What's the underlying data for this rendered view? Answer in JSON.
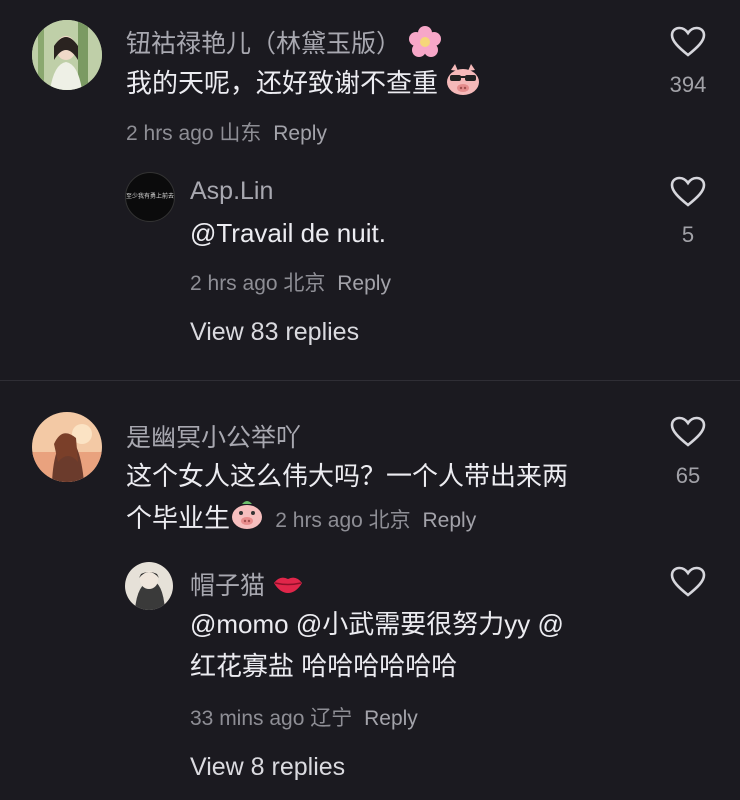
{
  "comments": [
    {
      "username": "钮祜禄艳儿（林黛玉版）",
      "text": "我的天呢，还好致谢不查重",
      "time": "2 hrs ago",
      "location": "山东",
      "reply_label": "Reply",
      "likes": "394",
      "username_emoji": "flower-emoji",
      "text_emoji": "sunglasses-pig-emoji",
      "replies": [
        {
          "username": "Asp.Lin",
          "text": "@Travail de nuit.",
          "time": "2 hrs ago",
          "location": "北京",
          "reply_label": "Reply",
          "likes": "5",
          "avatar_text": "至少我有勇上前去"
        }
      ],
      "view_more": "View 83 replies"
    },
    {
      "username": "是幽冥小公举吖",
      "text_line1": "这个女人这么伟大吗？一个人带出来两",
      "text_line2": "个毕业生",
      "time": "2 hrs ago",
      "location": "北京",
      "reply_label": "Reply",
      "likes": "65",
      "text_emoji": "pig-face-emoji",
      "replies": [
        {
          "username": "帽子猫",
          "username_emoji": "lips-emoji",
          "text_line1": "@momo @小武需要很努力yy @",
          "text_line2": "红花寡盐 哈哈哈哈哈哈",
          "time": "33 mins ago",
          "location": "辽宁",
          "reply_label": "Reply"
        }
      ],
      "view_more": "View 8 replies"
    }
  ],
  "colors": {
    "background": "#1b1a20",
    "primary_text": "#ececf1",
    "secondary_text": "#8e8e95",
    "divider": "#2f2e35"
  }
}
